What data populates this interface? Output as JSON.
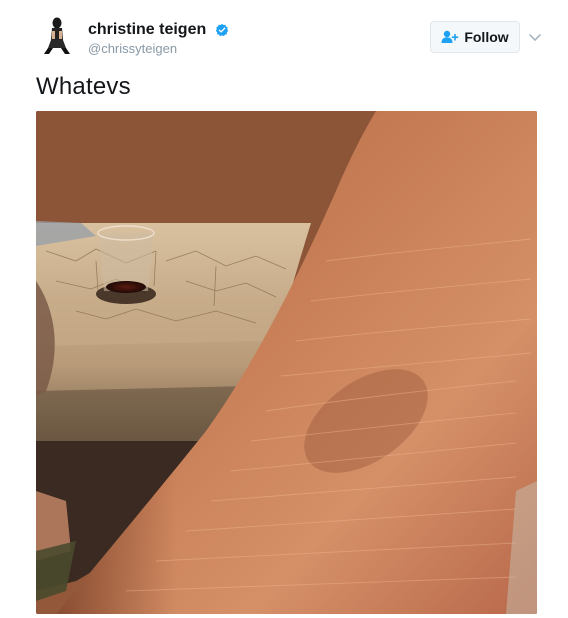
{
  "user": {
    "display_name": "christine teigen",
    "handle": "@chrissyteigen",
    "verified": true,
    "avatar_icon": "profile-photo"
  },
  "actions": {
    "follow_label": "Follow",
    "follow_icon": "add-user-icon",
    "more_icon": "chevron-down-icon"
  },
  "tweet": {
    "text": "Whatevs",
    "media_description_icon": "photo"
  },
  "colors": {
    "verified_blue": "#1da1f2",
    "text_primary": "#14171a",
    "text_secondary": "#8899a6",
    "button_border": "#e1e8ed",
    "button_bg": "#f5f8fa"
  }
}
